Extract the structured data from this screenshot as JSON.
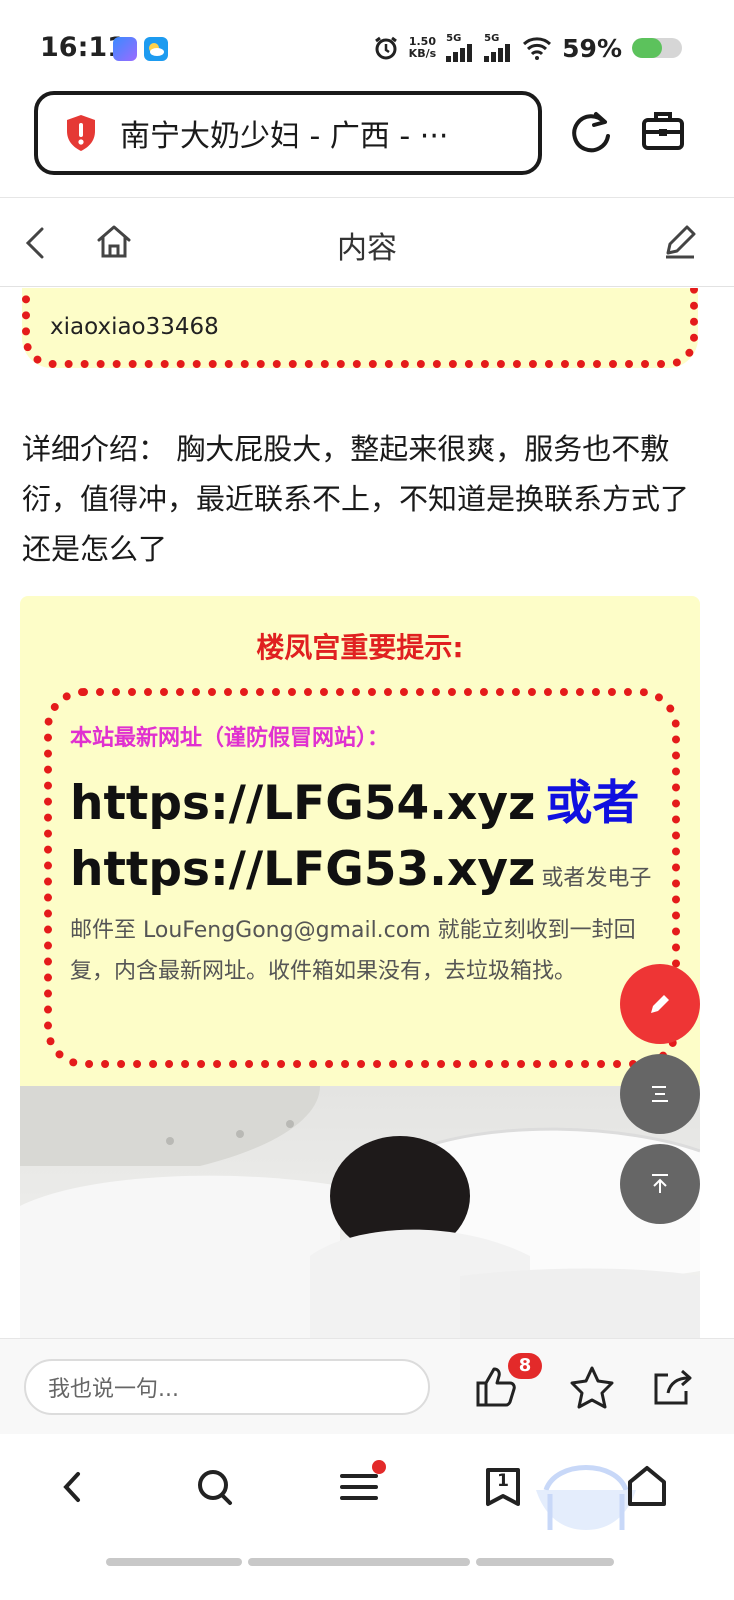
{
  "status_bar": {
    "time": "16:11",
    "net_speed_value": "1.50",
    "net_speed_unit": "KB/s",
    "signal1_label": "5G",
    "signal2_label": "5G",
    "battery_percent": "59%",
    "battery_level": 0.59,
    "battery_color": "#5cc25c"
  },
  "address_bar": {
    "text": "南宁大奶少妇 - 广西 - ···",
    "shield_color": "#e53935"
  },
  "nav_bar": {
    "title": "内容"
  },
  "content": {
    "top_card_text": "xiaoxiao33468",
    "intro": "详细介绍： 胸大屁股大，整起来很爽，服务也不敷衍，值得冲，最近联系不上，不知道是换联系方式了还是怎么了",
    "notice": {
      "title": "楼凤宫重要提示:",
      "subtitle": "本站最新网址（谨防假冒网站）：",
      "url1": "https://LFG54.xyz",
      "or_label": "或者",
      "url2": "https://LFG53.xyz",
      "or_email": "或者发电子",
      "body": "邮件至 LouFengGong@gmail.com 就能立刻收到一封回复，内含最新网址。收件箱如果没有，去垃圾箱找。"
    }
  },
  "comment_bar": {
    "placeholder": "我也说一句...",
    "like_count": "8"
  },
  "bottom_nav": {
    "tabs_count": "1"
  },
  "colors": {
    "accent_red": "#e41b1b",
    "notice_bg": "#fdfdc8",
    "link_blue": "#1010e0",
    "magenta": "#e030d0"
  }
}
